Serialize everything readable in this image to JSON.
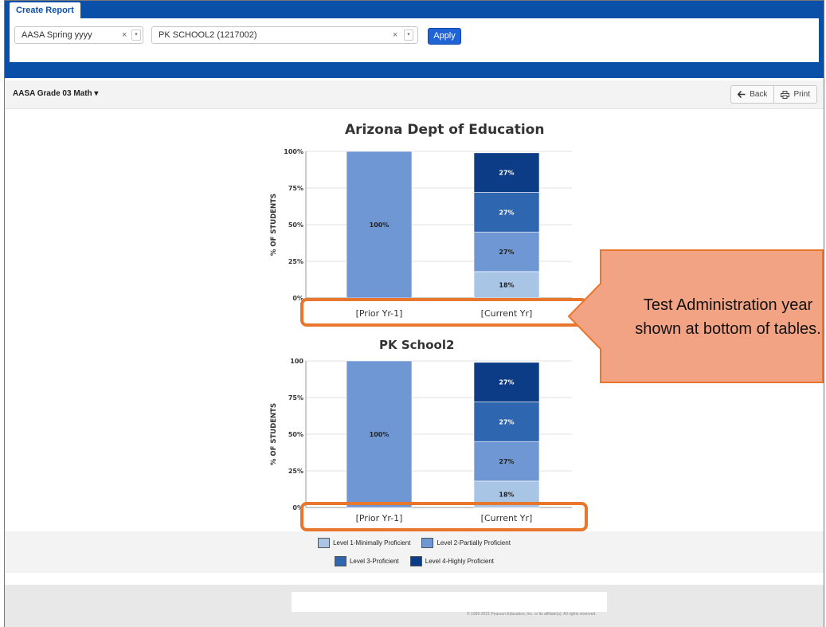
{
  "header": {
    "tab_label": "Create Report",
    "admin_select": {
      "value": "AASA Spring yyyy",
      "clear": "×",
      "caret": "▾"
    },
    "school_select": {
      "value": "PK SCHOOL2 (1217002)",
      "clear": "×",
      "caret": "▾"
    },
    "apply_label": "Apply"
  },
  "toolbar": {
    "report_menu_label": "AASA Grade 03 Math ▾",
    "back_label": "Back",
    "print_label": "Print"
  },
  "chart_data": [
    {
      "type": "bar",
      "stacked": true,
      "title": "Arizona Dept of Education",
      "ylabel": "% OF STUDENTS",
      "yticks": [
        "0%",
        "25%",
        "50%",
        "75%",
        "100%"
      ],
      "ylim": [
        0,
        100
      ],
      "categories": [
        "[Prior Yr-1]",
        "[Current Yr]"
      ],
      "series": [
        {
          "values": [
            0,
            18
          ],
          "labels": [
            "",
            "18%"
          ]
        },
        {
          "values": [
            100,
            27
          ],
          "labels": [
            "100%",
            "27%"
          ]
        },
        {
          "values": [
            0,
            27
          ],
          "labels": [
            "",
            "27%"
          ]
        },
        {
          "values": [
            0,
            27
          ],
          "labels": [
            "",
            "27%"
          ]
        }
      ]
    },
    {
      "type": "bar",
      "stacked": true,
      "title": "PK School2",
      "ylabel": "% OF STUDENTS",
      "yticks": [
        "0%",
        "25%",
        "50%",
        "75%",
        "100"
      ],
      "ylim": [
        0,
        100
      ],
      "categories": [
        "[Prior Yr-1]",
        "[Current Yr]"
      ],
      "series": [
        {
          "values": [
            0,
            18
          ],
          "labels": [
            "",
            "18%"
          ]
        },
        {
          "values": [
            100,
            27
          ],
          "labels": [
            "100%",
            "27%"
          ]
        },
        {
          "values": [
            0,
            27
          ],
          "labels": [
            "",
            "27%"
          ]
        },
        {
          "values": [
            0,
            27
          ],
          "labels": [
            "",
            "27%"
          ]
        }
      ]
    }
  ],
  "series_colors": [
    "#a9c5e6",
    "#6f97d4",
    "#2f66b0",
    "#0c3c85"
  ],
  "legend": [
    "Level 1-Minimally Proficient",
    "Level 2-Partially Proficient",
    "Level 3-Proficient",
    "Level 4-Highly Proficient"
  ],
  "callout": {
    "text": "Test Administration year shown at bottom of tables.",
    "color": "#f2a383"
  },
  "highlight_color": "#e8762c",
  "footer": {
    "copyright": "© 1999-2021 Pearson Education, Inc. or its affiliate(s). All rights reserved."
  }
}
